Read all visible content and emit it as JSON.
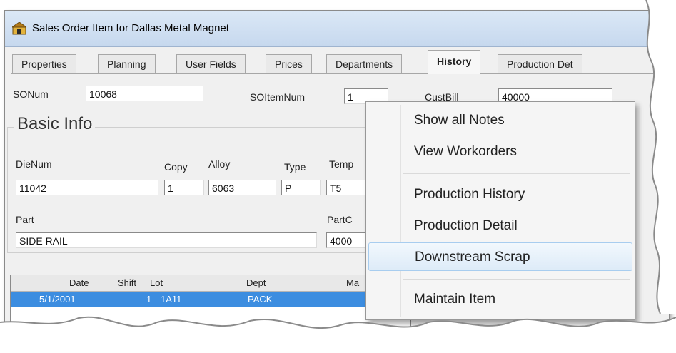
{
  "window": {
    "title": "Sales Order Item for Dallas Metal Magnet"
  },
  "tabs": [
    "Properties",
    "Planning",
    "User Fields",
    "Prices",
    "Departments",
    "History",
    "Production Det"
  ],
  "active_tab": "History",
  "header_fields": {
    "sonum_label": "SONum",
    "sonum_value": "10068",
    "soitemnum_label": "SOItemNum",
    "soitemnum_value": "1",
    "custbill_label": "CustBill",
    "custbill_value": "40000"
  },
  "basic_info": {
    "title": "Basic Info",
    "dienum_label": "DieNum",
    "dienum_value": "11042",
    "copy_label": "Copy",
    "copy_value": "1",
    "alloy_label": "Alloy",
    "alloy_value": "6063",
    "type_label": "Type",
    "type_value": "P",
    "temp_label": "Temp",
    "temp_value": "T5",
    "part_label": "Part",
    "part_value": "SIDE RAIL",
    "partc_label": "PartC",
    "partc_value": "4000"
  },
  "grid": {
    "columns": [
      "Date",
      "Shift",
      "Lot",
      "Dept",
      "Ma"
    ],
    "rows": [
      {
        "date": "5/1/2001",
        "shift": "1",
        "lot": "1A11",
        "dept": "PACK"
      }
    ]
  },
  "context_menu": {
    "items": [
      "Show all Notes",
      "View Workorders",
      "Production History",
      "Production Detail",
      "Downstream Scrap",
      "Maintain Item"
    ],
    "hovered": "Downstream Scrap"
  },
  "colors": {
    "selection": "#3c8de0",
    "menu_hover": "#ddebf8",
    "titlebar": "#c6d8ee"
  }
}
